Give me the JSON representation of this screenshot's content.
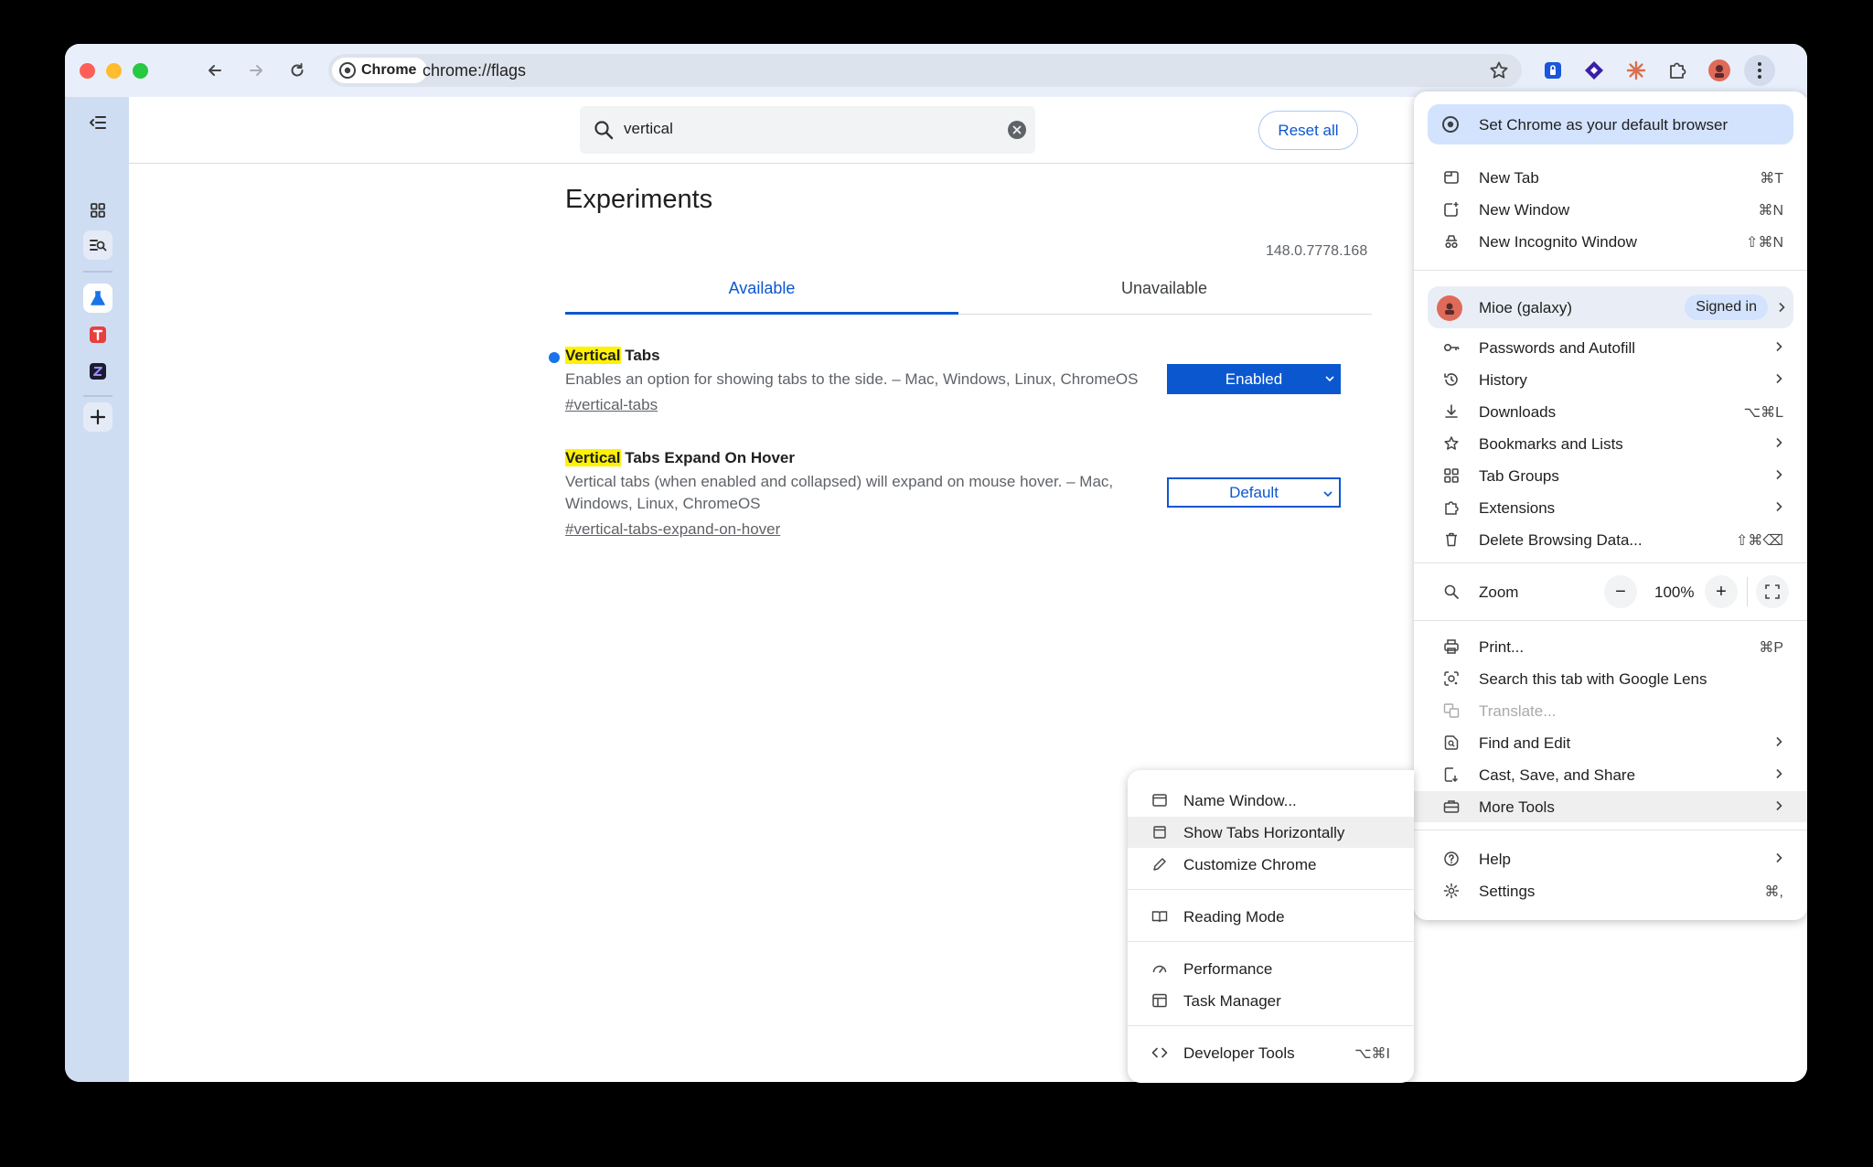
{
  "browser": {
    "chip_label": "Chrome",
    "url": "chrome://flags"
  },
  "search": {
    "query": "vertical",
    "reset_label": "Reset all"
  },
  "page": {
    "title": "Experiments",
    "version": "148.0.7778.168",
    "tabs": [
      {
        "label": "Available",
        "active": true
      },
      {
        "label": "Unavailable",
        "active": false
      }
    ],
    "flags": [
      {
        "highlight": "Vertical",
        "name_rest": " Tabs",
        "description": "Enables an option for showing tabs to the side. – Mac, Windows, Linux, ChromeOS",
        "link": "#vertical-tabs",
        "state": "Enabled"
      },
      {
        "highlight": "Vertical",
        "name_rest": " Tabs Expand On Hover",
        "description": "Vertical tabs (when enabled and collapsed) will expand on mouse hover. – Mac, Windows, Linux, ChromeOS",
        "link": "#vertical-tabs-expand-on-hover",
        "state": "Default"
      }
    ]
  },
  "menu": {
    "default_banner": "Set Chrome as your default browser",
    "new_tab": {
      "label": "New Tab",
      "shortcut": "⌘T"
    },
    "new_window": {
      "label": "New Window",
      "shortcut": "⌘N"
    },
    "new_incognito": {
      "label": "New Incognito Window",
      "shortcut": "⇧⌘N"
    },
    "profile": {
      "name": "Mioe (galaxy)",
      "status": "Signed in"
    },
    "passwords": {
      "label": "Passwords and Autofill"
    },
    "history": {
      "label": "History"
    },
    "downloads": {
      "label": "Downloads",
      "shortcut": "⌥⌘L"
    },
    "bookmarks": {
      "label": "Bookmarks and Lists"
    },
    "tab_groups": {
      "label": "Tab Groups"
    },
    "extensions": {
      "label": "Extensions"
    },
    "delete_data": {
      "label": "Delete Browsing Data...",
      "shortcut": "⇧⌘⌫"
    },
    "zoom": {
      "label": "Zoom",
      "minus": "−",
      "value": "100%",
      "plus": "+"
    },
    "print": {
      "label": "Print...",
      "shortcut": "⌘P"
    },
    "lens": {
      "label": "Search this tab with Google Lens"
    },
    "translate": {
      "label": "Translate..."
    },
    "find_edit": {
      "label": "Find and Edit"
    },
    "cast_save": {
      "label": "Cast, Save, and Share"
    },
    "more_tools": {
      "label": "More Tools"
    },
    "help": {
      "label": "Help"
    },
    "settings": {
      "label": "Settings",
      "shortcut": "⌘,"
    }
  },
  "submenu": {
    "name_window": "Name Window...",
    "show_tabs_horizontally": "Show Tabs Horizontally",
    "customize_chrome": "Customize Chrome",
    "reading_mode": "Reading Mode",
    "performance": "Performance",
    "task_manager": "Task Manager",
    "developer_tools": {
      "label": "Developer Tools",
      "shortcut": "⌥⌘I"
    }
  },
  "colors": {
    "accent": "#0b57d0",
    "toolbar_bg": "#e8effa",
    "sidebar_bg": "#cfddf3",
    "highlight": "#fff200"
  }
}
